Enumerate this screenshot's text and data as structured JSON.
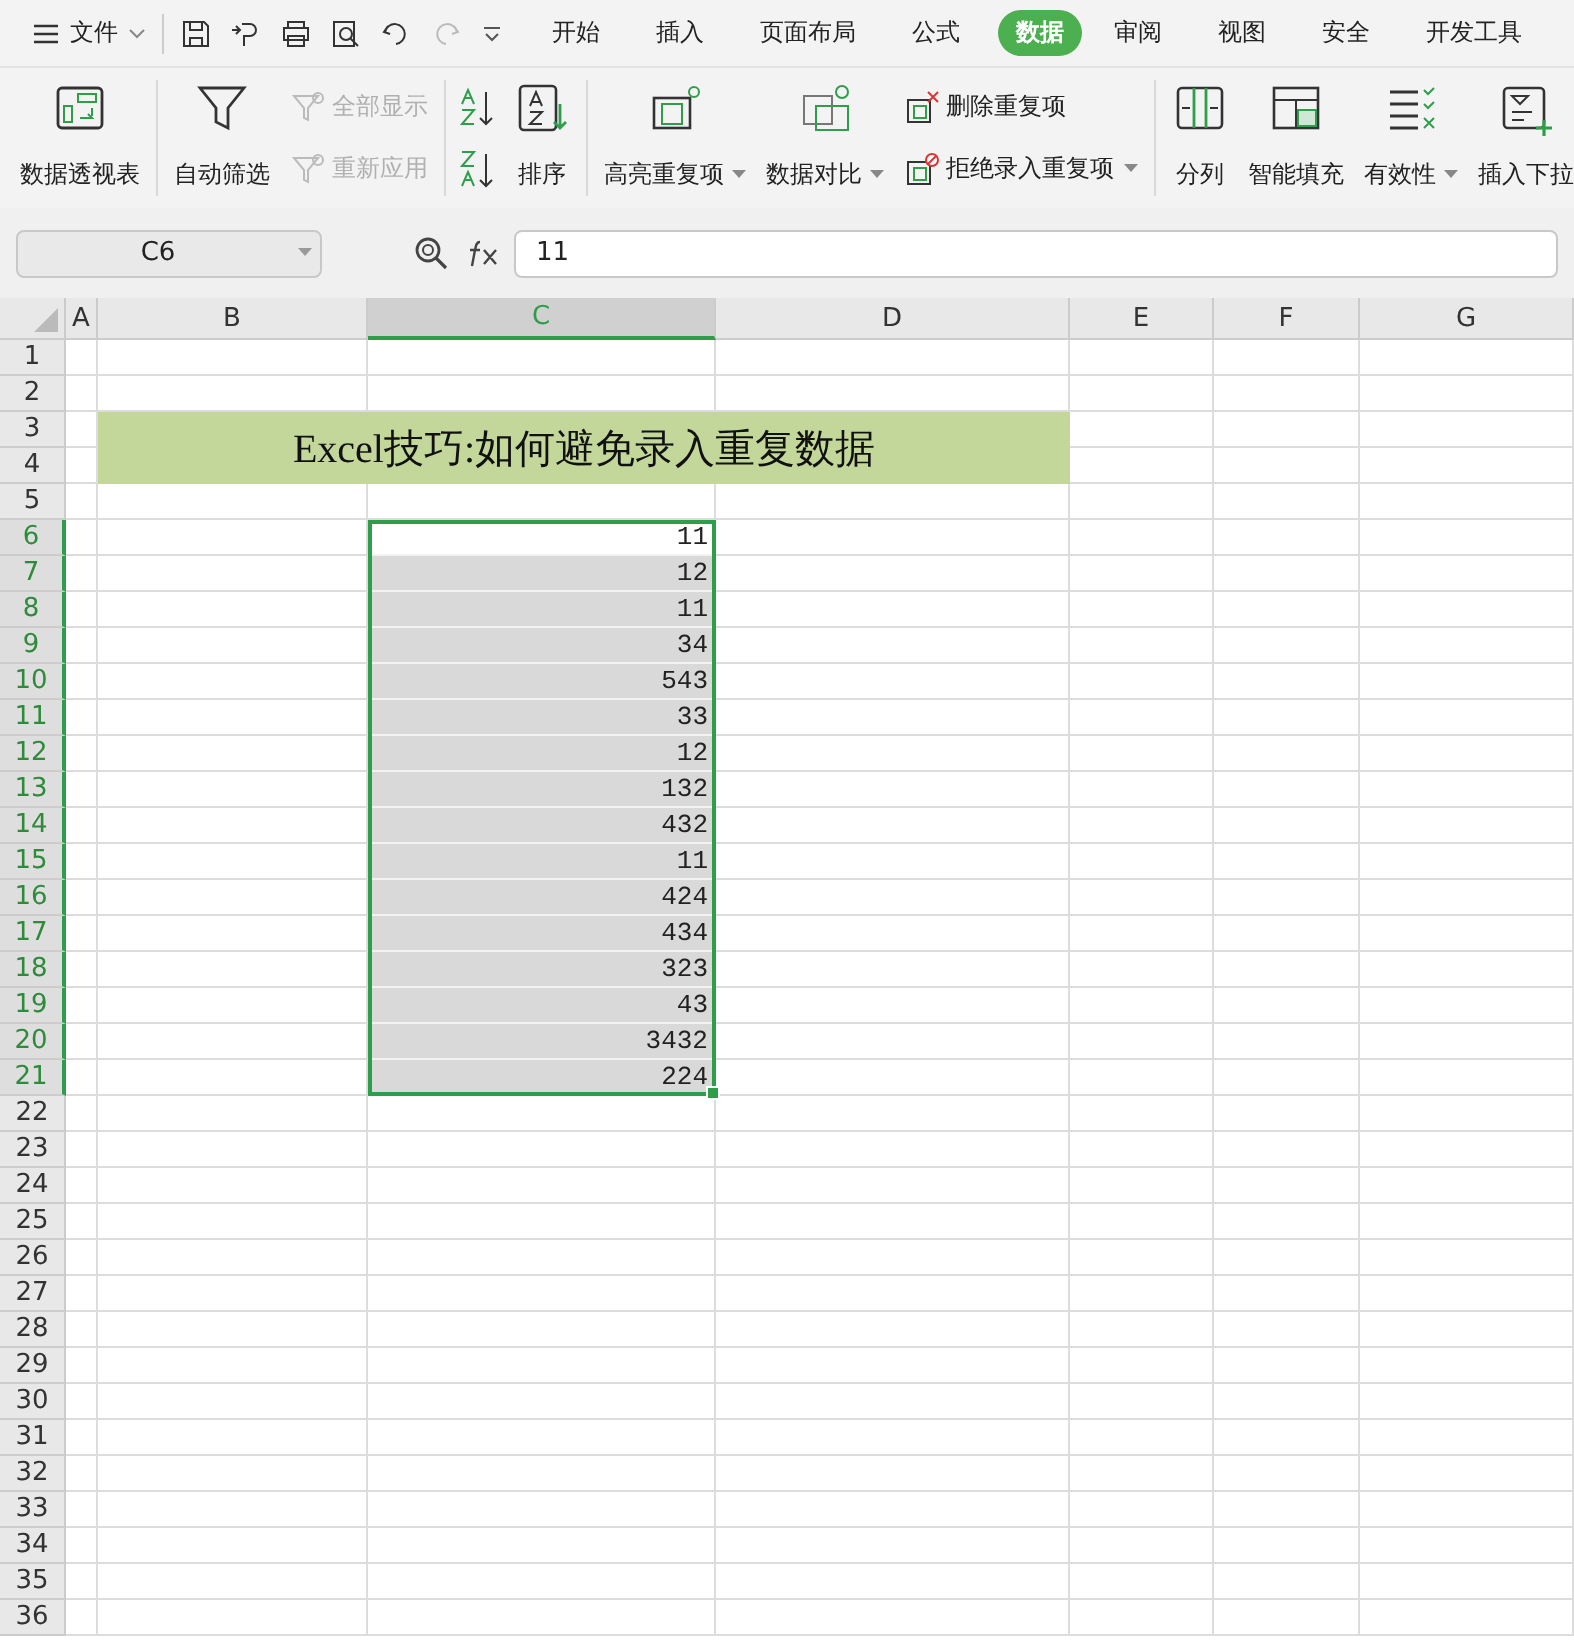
{
  "menu": {
    "label": "文件"
  },
  "tabs": [
    {
      "label": "开始",
      "selected": false
    },
    {
      "label": "插入",
      "selected": false
    },
    {
      "label": "页面布局",
      "selected": false
    },
    {
      "label": "公式",
      "selected": false
    },
    {
      "label": "数据",
      "selected": true
    },
    {
      "label": "审阅",
      "selected": false
    },
    {
      "label": "视图",
      "selected": false
    },
    {
      "label": "安全",
      "selected": false
    },
    {
      "label": "开发工具",
      "selected": false
    }
  ],
  "ribbon": [
    {
      "items": [
        {
          "kind": "large",
          "label": "数据透视表",
          "dropdown": false
        }
      ]
    },
    {
      "items": [
        {
          "kind": "large",
          "label": "自动筛选",
          "dropdown": false
        },
        {
          "kind": "stack",
          "children": [
            {
              "label": "全部显示",
              "disabled": true,
              "dropdown": false
            },
            {
              "label": "重新应用",
              "disabled": true,
              "dropdown": false
            }
          ]
        }
      ]
    },
    {
      "items": [
        {
          "kind": "sort-icons"
        },
        {
          "kind": "large",
          "label": "排序",
          "dropdown": false
        }
      ]
    },
    {
      "items": [
        {
          "kind": "large",
          "label": "高亮重复项",
          "dropdown": true
        },
        {
          "kind": "large",
          "label": "数据对比",
          "dropdown": true
        },
        {
          "kind": "stack",
          "children": [
            {
              "label": "删除重复项",
              "disabled": false,
              "dropdown": false
            },
            {
              "label": "拒绝录入重复项",
              "disabled": false,
              "dropdown": true
            }
          ]
        }
      ]
    },
    {
      "items": [
        {
          "kind": "large",
          "label": "分列",
          "dropdown": false
        },
        {
          "kind": "large",
          "label": "智能填充",
          "dropdown": false
        },
        {
          "kind": "large",
          "label": "有效性",
          "dropdown": true
        },
        {
          "kind": "large",
          "label": "插入下拉",
          "dropdown": false
        }
      ]
    }
  ],
  "name_box": "C6",
  "formula": "11",
  "columns": [
    {
      "label": "A",
      "selected": false
    },
    {
      "label": "B",
      "selected": false
    },
    {
      "label": "C",
      "selected": true
    },
    {
      "label": "D",
      "selected": false
    },
    {
      "label": "E",
      "selected": false
    },
    {
      "label": "F",
      "selected": false
    },
    {
      "label": "G",
      "selected": false
    }
  ],
  "rows": [
    {
      "label": "1",
      "selected": false
    },
    {
      "label": "2",
      "selected": false
    },
    {
      "label": "3",
      "selected": false
    },
    {
      "label": "4",
      "selected": false
    },
    {
      "label": "5",
      "selected": false
    },
    {
      "label": "6",
      "selected": true
    },
    {
      "label": "7",
      "selected": true
    },
    {
      "label": "8",
      "selected": true
    },
    {
      "label": "9",
      "selected": true
    },
    {
      "label": "10",
      "selected": true
    },
    {
      "label": "11",
      "selected": true
    },
    {
      "label": "12",
      "selected": true
    },
    {
      "label": "13",
      "selected": true
    },
    {
      "label": "14",
      "selected": true
    },
    {
      "label": "15",
      "selected": true
    },
    {
      "label": "16",
      "selected": true
    },
    {
      "label": "17",
      "selected": true
    },
    {
      "label": "18",
      "selected": true
    },
    {
      "label": "19",
      "selected": true
    },
    {
      "label": "20",
      "selected": true
    },
    {
      "label": "21",
      "selected": true
    },
    {
      "label": "22",
      "selected": false
    },
    {
      "label": "23",
      "selected": false
    },
    {
      "label": "24",
      "selected": false
    },
    {
      "label": "25",
      "selected": false
    },
    {
      "label": "26",
      "selected": false
    },
    {
      "label": "27",
      "selected": false
    },
    {
      "label": "28",
      "selected": false
    },
    {
      "label": "29",
      "selected": false
    },
    {
      "label": "30",
      "selected": false
    },
    {
      "label": "31",
      "selected": false
    },
    {
      "label": "32",
      "selected": false
    },
    {
      "label": "33",
      "selected": false
    },
    {
      "label": "34",
      "selected": false
    },
    {
      "label": "35",
      "selected": false
    },
    {
      "label": "36",
      "selected": false
    }
  ],
  "title_cell": "Excel技巧:如何避免录入重复数据",
  "data_cells": [
    {
      "value": "11",
      "active": true
    },
    {
      "value": "12",
      "active": false
    },
    {
      "value": "11",
      "active": false
    },
    {
      "value": "34",
      "active": false
    },
    {
      "value": "543",
      "active": false
    },
    {
      "value": "33",
      "active": false
    },
    {
      "value": "12",
      "active": false
    },
    {
      "value": "132",
      "active": false
    },
    {
      "value": "432",
      "active": false
    },
    {
      "value": "11",
      "active": false
    },
    {
      "value": "424",
      "active": false
    },
    {
      "value": "434",
      "active": false
    },
    {
      "value": "323",
      "active": false
    },
    {
      "value": "43",
      "active": false
    },
    {
      "value": "3432",
      "active": false
    },
    {
      "value": "224",
      "active": false
    }
  ]
}
